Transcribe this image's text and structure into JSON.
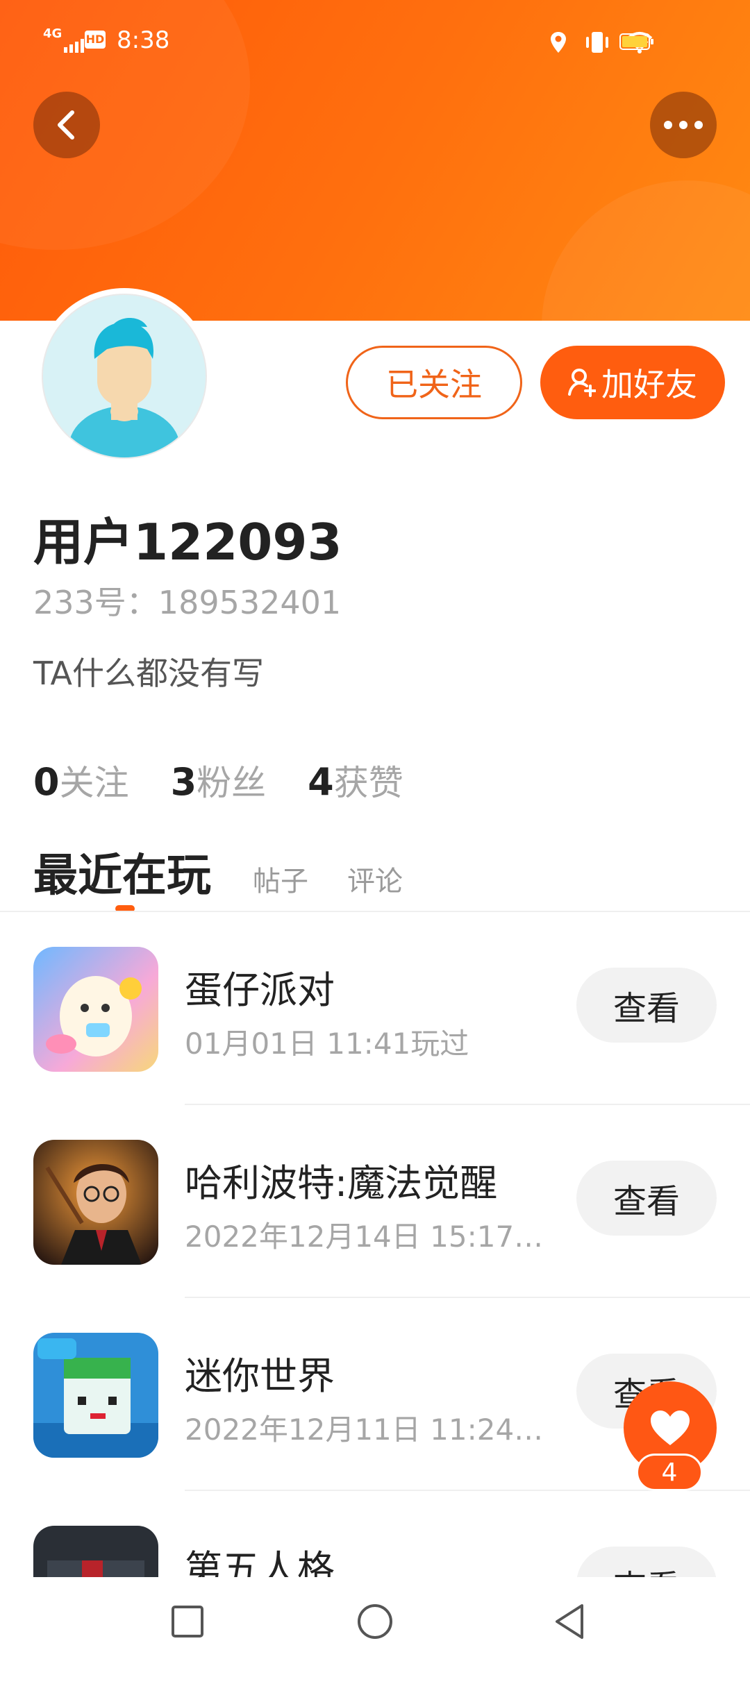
{
  "status_bar": {
    "network": "4G",
    "hd": "HD",
    "time": "8:38",
    "icons": [
      "location-icon",
      "vibrate-icon",
      "wifi-icon",
      "battery-icon"
    ]
  },
  "header": {
    "back_icon": "back-arrow-icon",
    "more_icon": "more-dots-icon",
    "accent_color": "#ff6a10"
  },
  "profile": {
    "followed_label": "已关注",
    "add_friend_label": "加好友",
    "username": "用户122093",
    "uid_text": "233号：189532401",
    "bio": "TA什么都没有写"
  },
  "stats": [
    {
      "num": "0",
      "label": "关注"
    },
    {
      "num": "3",
      "label": "粉丝"
    },
    {
      "num": "4",
      "label": "获赞"
    }
  ],
  "tabs": [
    {
      "label": "最近在玩",
      "active": true
    },
    {
      "label": "帖子",
      "active": false
    },
    {
      "label": "评论",
      "active": false
    }
  ],
  "games": [
    {
      "title": "蛋仔派对",
      "meta": "01月01日  11:41玩过",
      "button": "查看"
    },
    {
      "title": "哈利波特:魔法觉醒",
      "meta": "2022年12月14日  15:17…",
      "button": "查看"
    },
    {
      "title": "迷你世界",
      "meta": "2022年12月11日  11:24…",
      "button": "查看"
    },
    {
      "title": "第五人格",
      "meta": "",
      "button": "查看"
    }
  ],
  "fab": {
    "count": "4",
    "icon": "heart-icon"
  },
  "navbar": {
    "icons": [
      "recent-apps-icon",
      "home-icon",
      "back-nav-icon"
    ]
  }
}
